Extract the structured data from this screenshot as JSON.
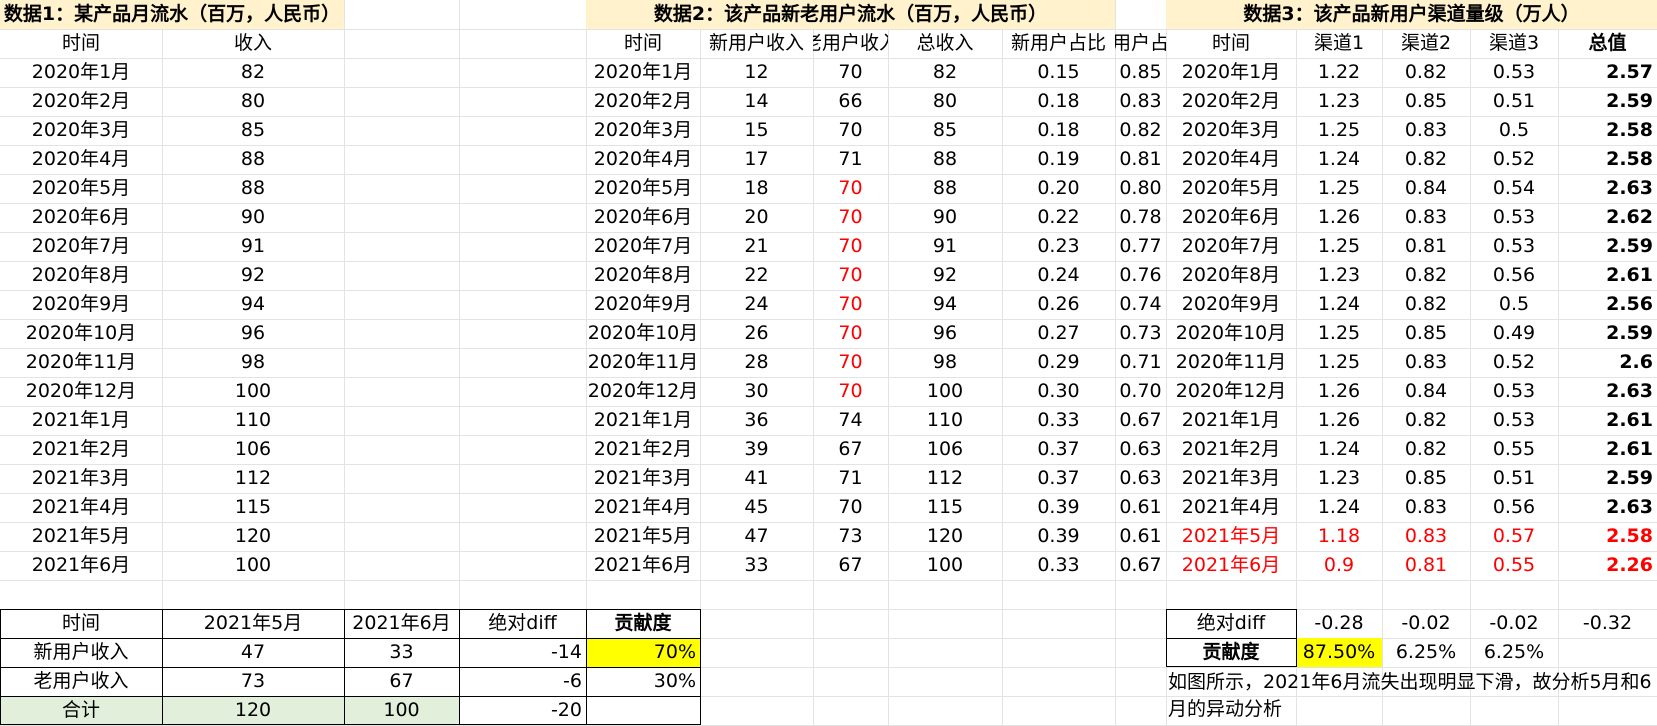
{
  "table1": {
    "title": "数据1：某产品月流水（百万，人民币）",
    "headers": [
      "时间",
      "收入"
    ],
    "rows": [
      [
        "2020年1月",
        "82"
      ],
      [
        "2020年2月",
        "80"
      ],
      [
        "2020年3月",
        "85"
      ],
      [
        "2020年4月",
        "88"
      ],
      [
        "2020年5月",
        "88"
      ],
      [
        "2020年6月",
        "90"
      ],
      [
        "2020年7月",
        "91"
      ],
      [
        "2020年8月",
        "92"
      ],
      [
        "2020年9月",
        "94"
      ],
      [
        "2020年10月",
        "96"
      ],
      [
        "2020年11月",
        "98"
      ],
      [
        "2020年12月",
        "100"
      ],
      [
        "2021年1月",
        "110"
      ],
      [
        "2021年2月",
        "106"
      ],
      [
        "2021年3月",
        "112"
      ],
      [
        "2021年4月",
        "115"
      ],
      [
        "2021年5月",
        "120"
      ],
      [
        "2021年6月",
        "100"
      ]
    ]
  },
  "table2": {
    "title": "数据2：该产品新老用户流水（百万，人民币）",
    "headers": [
      "时间",
      "新用户收入",
      "老用户收入",
      "总收入",
      "新用户占比",
      "老用户占比"
    ],
    "rows": [
      [
        "2020年1月",
        "12",
        "70",
        "82",
        "0.15",
        "0.85"
      ],
      [
        "2020年2月",
        "14",
        "66",
        "80",
        "0.18",
        "0.83"
      ],
      [
        "2020年3月",
        "15",
        "70",
        "85",
        "0.18",
        "0.82"
      ],
      [
        "2020年4月",
        "17",
        "71",
        "88",
        "0.19",
        "0.81"
      ],
      [
        "2020年5月",
        "18",
        "70",
        "88",
        "0.20",
        "0.80"
      ],
      [
        "2020年6月",
        "20",
        "70",
        "90",
        "0.22",
        "0.78"
      ],
      [
        "2020年7月",
        "21",
        "70",
        "91",
        "0.23",
        "0.77"
      ],
      [
        "2020年8月",
        "22",
        "70",
        "92",
        "0.24",
        "0.76"
      ],
      [
        "2020年9月",
        "24",
        "70",
        "94",
        "0.26",
        "0.74"
      ],
      [
        "2020年10月",
        "26",
        "70",
        "96",
        "0.27",
        "0.73"
      ],
      [
        "2020年11月",
        "28",
        "70",
        "98",
        "0.29",
        "0.71"
      ],
      [
        "2020年12月",
        "30",
        "70",
        "100",
        "0.30",
        "0.70"
      ],
      [
        "2021年1月",
        "36",
        "74",
        "110",
        "0.33",
        "0.67"
      ],
      [
        "2021年2月",
        "39",
        "67",
        "106",
        "0.37",
        "0.63"
      ],
      [
        "2021年3月",
        "41",
        "71",
        "112",
        "0.37",
        "0.63"
      ],
      [
        "2021年4月",
        "45",
        "70",
        "115",
        "0.39",
        "0.61"
      ],
      [
        "2021年5月",
        "47",
        "73",
        "120",
        "0.39",
        "0.61"
      ],
      [
        "2021年6月",
        "33",
        "67",
        "100",
        "0.33",
        "0.67"
      ]
    ],
    "red_old_rows": [
      4,
      5,
      6,
      7,
      8,
      9,
      10,
      11
    ]
  },
  "table3": {
    "title": "数据3：该产品新用户渠道量级（万人）",
    "headers": [
      "时间",
      "渠道1",
      "渠道2",
      "渠道3",
      "总值"
    ],
    "rows": [
      [
        "2020年1月",
        "1.22",
        "0.82",
        "0.53",
        "2.57"
      ],
      [
        "2020年2月",
        "1.23",
        "0.85",
        "0.51",
        "2.59"
      ],
      [
        "2020年3月",
        "1.25",
        "0.83",
        "0.5",
        "2.58"
      ],
      [
        "2020年4月",
        "1.24",
        "0.82",
        "0.52",
        "2.58"
      ],
      [
        "2020年5月",
        "1.25",
        "0.84",
        "0.54",
        "2.63"
      ],
      [
        "2020年6月",
        "1.26",
        "0.83",
        "0.53",
        "2.62"
      ],
      [
        "2020年7月",
        "1.25",
        "0.81",
        "0.53",
        "2.59"
      ],
      [
        "2020年8月",
        "1.23",
        "0.82",
        "0.56",
        "2.61"
      ],
      [
        "2020年9月",
        "1.24",
        "0.82",
        "0.5",
        "2.56"
      ],
      [
        "2020年10月",
        "1.25",
        "0.85",
        "0.49",
        "2.59"
      ],
      [
        "2020年11月",
        "1.25",
        "0.83",
        "0.52",
        "2.6"
      ],
      [
        "2020年12月",
        "1.26",
        "0.84",
        "0.53",
        "2.63"
      ],
      [
        "2021年1月",
        "1.26",
        "0.82",
        "0.53",
        "2.61"
      ],
      [
        "2021年2月",
        "1.24",
        "0.82",
        "0.55",
        "2.61"
      ],
      [
        "2021年3月",
        "1.23",
        "0.85",
        "0.51",
        "2.59"
      ],
      [
        "2021年4月",
        "1.24",
        "0.83",
        "0.56",
        "2.63"
      ],
      [
        "2021年5月",
        "1.18",
        "0.83",
        "0.57",
        "2.58"
      ],
      [
        "2021年6月",
        "0.9",
        "0.81",
        "0.55",
        "2.26"
      ]
    ],
    "red_rows": [
      16,
      17
    ]
  },
  "summary1": {
    "headers": [
      "时间",
      "2021年5月",
      "2021年6月",
      "绝对diff",
      "贡献度"
    ],
    "rows": [
      [
        "新用户收入",
        "47",
        "33",
        "-14",
        "70%"
      ],
      [
        "老用户收入",
        "73",
        "67",
        "-6",
        "30%"
      ],
      [
        "合计",
        "120",
        "100",
        "-20",
        ""
      ]
    ]
  },
  "summary2": {
    "diff_row": [
      "绝对diff",
      "-0.28",
      "-0.02",
      "-0.02",
      "-0.32"
    ],
    "contrib_row": [
      "贡献度",
      "87.50%",
      "6.25%",
      "6.25%"
    ]
  },
  "note": "如图所示，2021年6月流失出现明显下滑，故分析5月和6月的异动分析",
  "colors": {
    "title_bg": "#fff2cc",
    "highlight_yellow": "#ffff00",
    "total_row_green": "#e2efda",
    "red_text": "#ff0000",
    "gridline": "#e3e3e3"
  }
}
